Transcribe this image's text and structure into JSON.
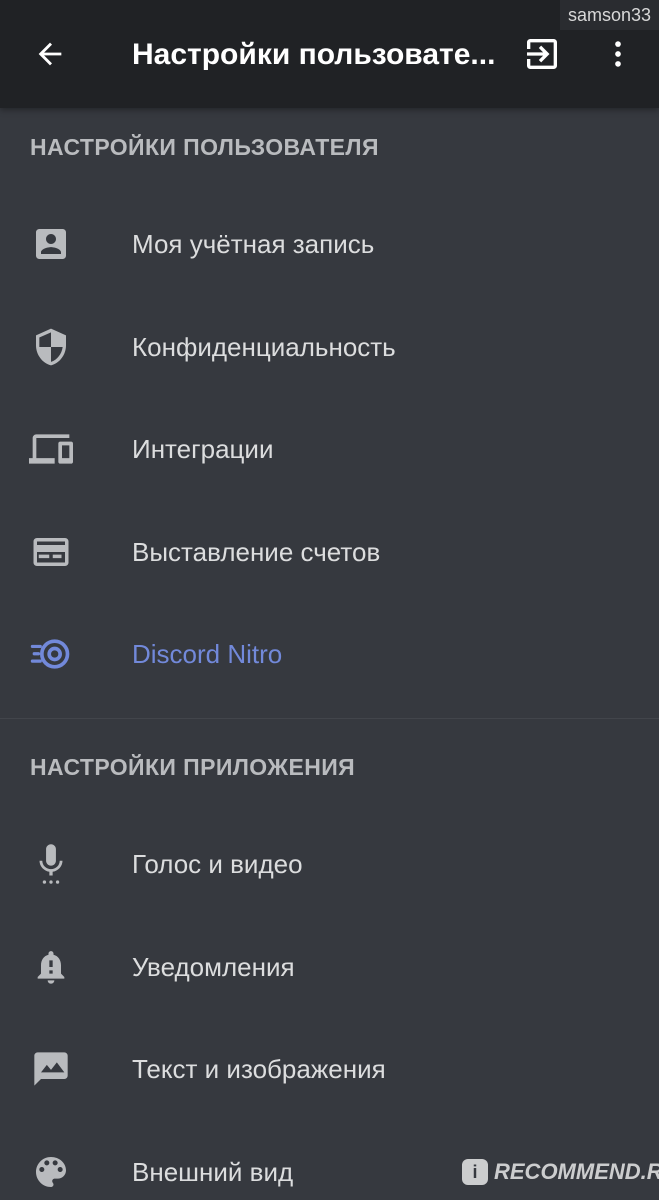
{
  "watermark": "samson33",
  "appbar": {
    "title": "Настройки пользовате...",
    "back_icon": "arrow-left-icon",
    "logout_icon": "logout-icon",
    "more_icon": "more-vertical-icon"
  },
  "sections": {
    "user": {
      "header": "НАСТРОЙКИ ПОЛЬЗОВАТЕЛЯ",
      "items": [
        {
          "label": "Моя учётная запись",
          "icon": "account-icon"
        },
        {
          "label": "Конфиденциальность",
          "icon": "shield-icon"
        },
        {
          "label": "Интеграции",
          "icon": "devices-icon"
        },
        {
          "label": "Выставление счетов",
          "icon": "credit-card-icon"
        },
        {
          "label": "Discord Nitro",
          "icon": "nitro-icon"
        }
      ]
    },
    "app": {
      "header": "НАСТРОЙКИ ПРИЛОЖЕНИЯ",
      "items": [
        {
          "label": "Голос и видео",
          "icon": "microphone-icon"
        },
        {
          "label": "Уведомления",
          "icon": "bell-icon"
        },
        {
          "label": "Текст и изображения",
          "icon": "image-icon"
        },
        {
          "label": "Внешний вид",
          "icon": "palette-icon"
        }
      ]
    }
  },
  "footer_mark": {
    "badge": "i",
    "text": "RECOMMEND.RU"
  },
  "colors": {
    "background": "#36393f",
    "appbar": "#202225",
    "text": "#dcddde",
    "header": "#b9bbbe",
    "nitro_accent": "#7289da"
  }
}
